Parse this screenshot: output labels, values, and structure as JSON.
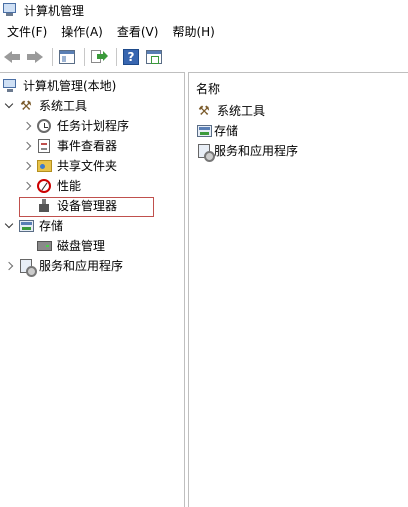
{
  "window": {
    "title": "计算机管理"
  },
  "menu": {
    "file": "文件(F)",
    "action": "操作(A)",
    "view": "查看(V)",
    "help": "帮助(H)"
  },
  "toolbar": {
    "help_glyph": "?"
  },
  "tree": {
    "root": "计算机管理(本地)",
    "system_tools": "系统工具",
    "task_scheduler": "任务计划程序",
    "event_viewer": "事件查看器",
    "shared_folders": "共享文件夹",
    "performance": "性能",
    "device_manager": "设备管理器",
    "storage": "存储",
    "disk_management": "磁盘管理",
    "services_apps": "服务和应用程序"
  },
  "list": {
    "column_name": "名称",
    "items": [
      "系统工具",
      "存储",
      "服务和应用程序"
    ]
  },
  "colors": {
    "selection_border": "#c0504d",
    "pane_border": "#bfbfbf"
  },
  "icons": {
    "app": "computer-management-icon",
    "back": "arrow-left-icon",
    "forward": "arrow-right-icon",
    "show_hide": "console-tree-icon",
    "export": "export-list-icon",
    "help": "help-icon",
    "properties": "properties-window-icon"
  }
}
